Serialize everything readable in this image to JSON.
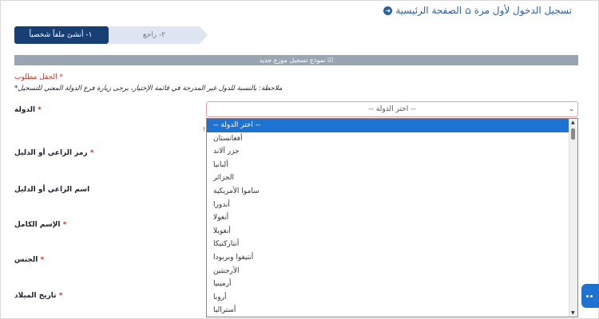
{
  "header": {
    "title": "تسجيل الدخول لأول مرة",
    "home_link": "الصفحة الرئيسية",
    "colors": {
      "link": "#2c5f9e"
    },
    "icons": [
      "home-icon",
      "back-arrow-icon"
    ]
  },
  "steps": [
    {
      "label": "١- أنشئ ملفاً شخصياً",
      "active": true
    },
    {
      "label": "٢- راجع",
      "active": false
    }
  ],
  "banner": "نموذج تسجيل موزع جديد",
  "required_note": "* الحقل مطلوب",
  "note": "ملاحظة: بالنسبة للدول غير المدرجة في قائمة الإختيار، يرجى زيارة فرع الدولة المعني للتسجيل*",
  "fields": {
    "country": "الدولة",
    "referrer_code": "رمز الراعي أو الدليل",
    "referrer_name": "اسم الراعي أو الدليل",
    "full_name": "الإسم الكامل",
    "gender": "الجنس",
    "birth_date": "تاريخ الميلاد"
  },
  "country_select": {
    "value": "-- اختر الدولة --",
    "options": [
      "-- اختر الدولة --",
      "أفغانستان",
      "جزر آلاند",
      "ألبانيا",
      "الجزائر",
      "ساموا الأمريكية",
      "أندورا",
      "أنغولا",
      "أنغويلا",
      "أنتاركتيكا",
      "أنتيغوا وبربودا",
      "الأرجنتين",
      "أرمينيا",
      "أروبا",
      "أستراليا"
    ]
  },
  "colors": {
    "accent": "#173f73",
    "selected": "#1e72d2",
    "required": "#c0392b"
  }
}
